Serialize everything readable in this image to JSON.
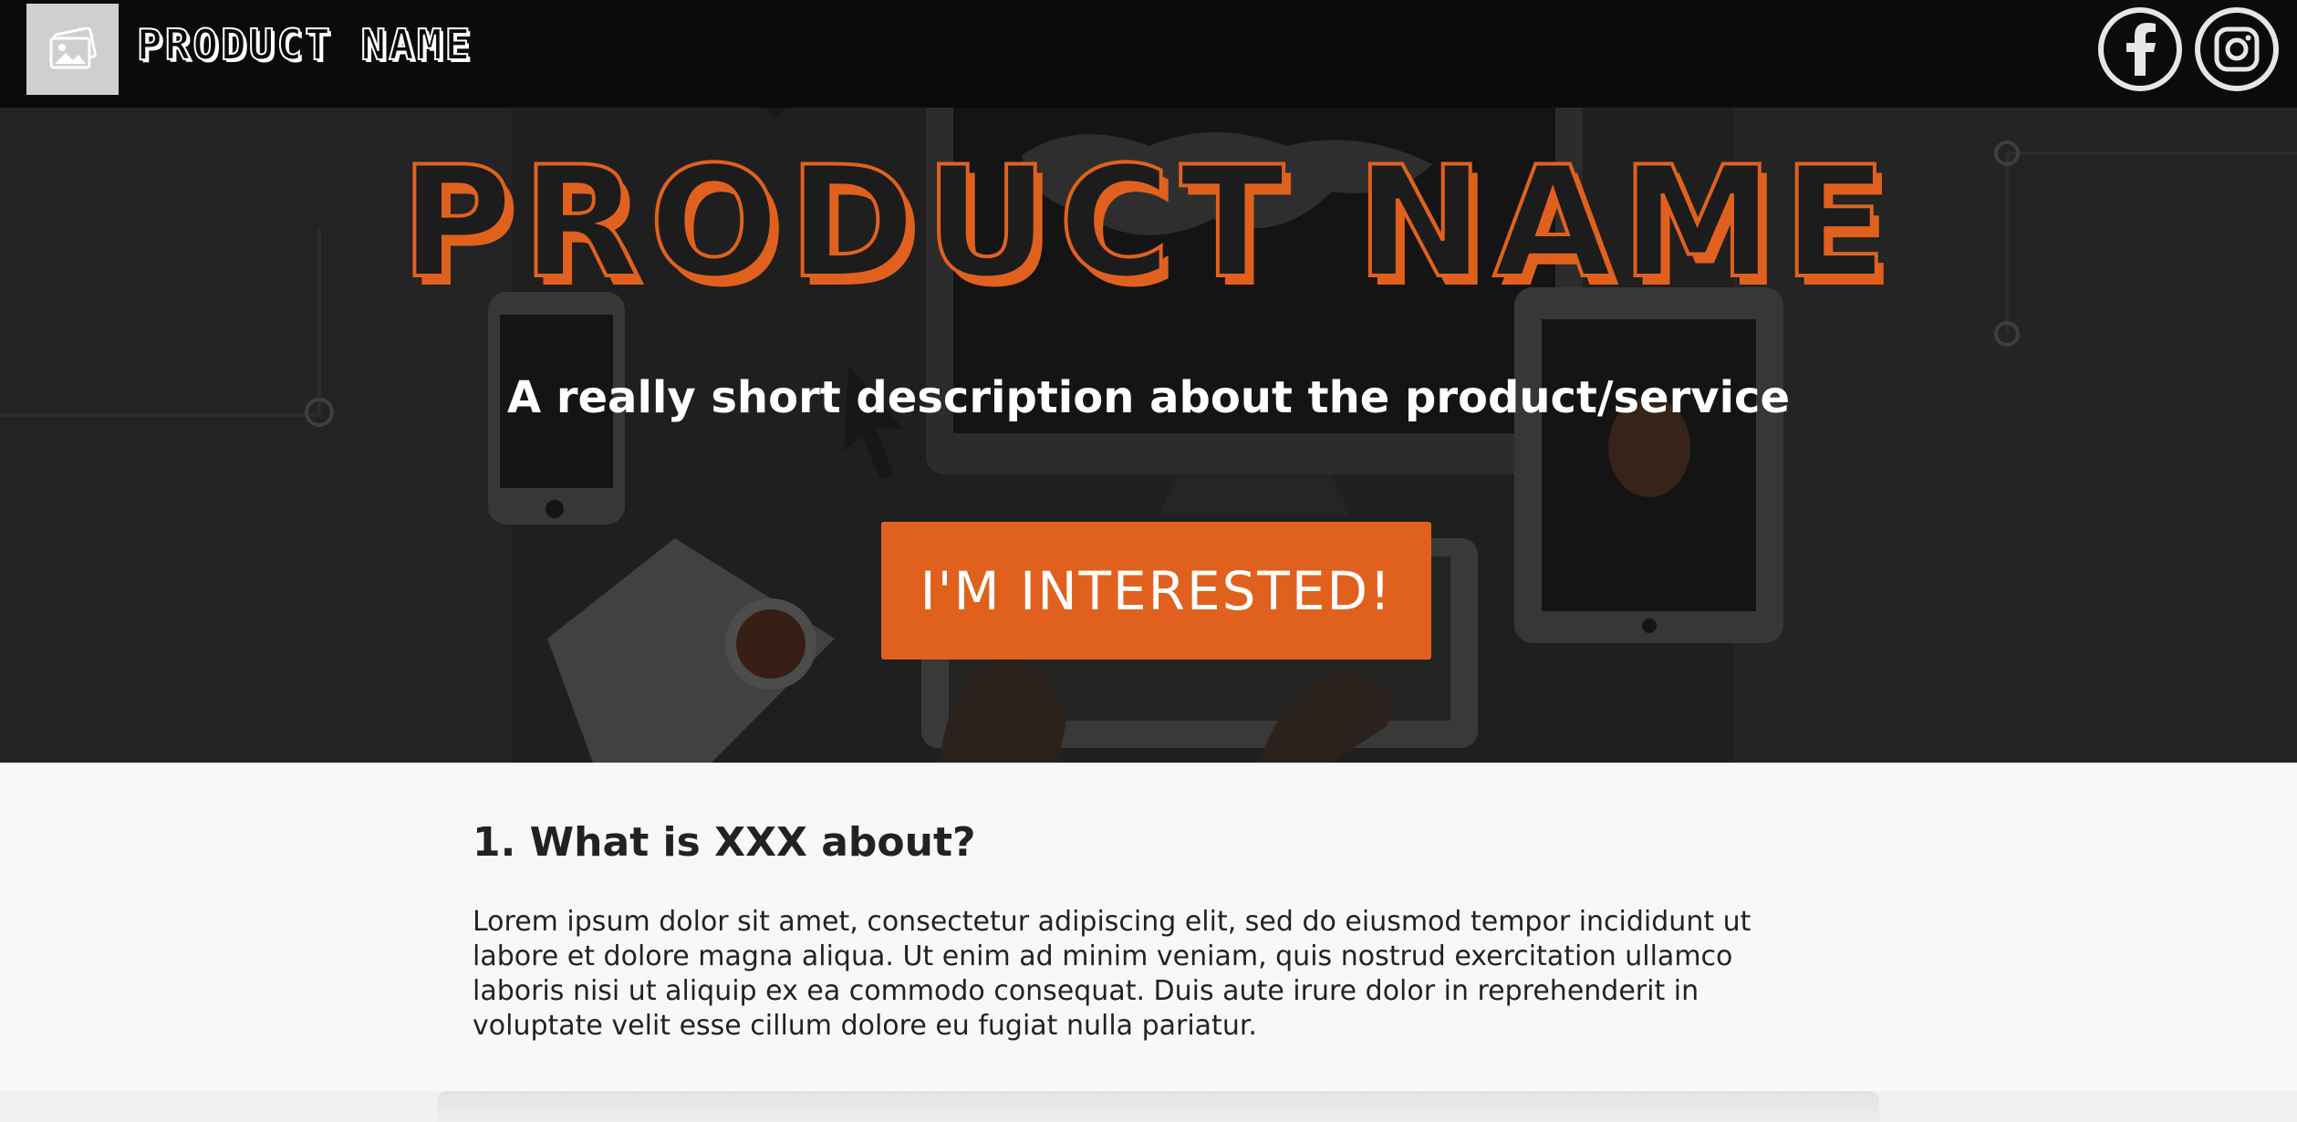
{
  "topbar": {
    "logo_icon": "image-icon",
    "brand_text": "PRODUCT NAME",
    "social": [
      {
        "icon": "facebook-icon"
      },
      {
        "icon": "instagram-icon"
      }
    ]
  },
  "hero": {
    "title": "PRODUCT NAME",
    "subtitle": "A really short description about the product/service",
    "cta_label": "I'M INTERESTED!"
  },
  "section": {
    "heading": "1. What is XXX about?",
    "body": "Lorem ipsum dolor sit amet, consectetur adipiscing elit, sed do eiusmod tempor incididunt ut labore et dolore magna aliqua. Ut enim ad minim veniam, quis nostrud exercitation ullamco laboris nisi ut aliquip ex ea commodo consequat. Duis aute irure dolor in reprehenderit in voluptate velit esse cillum dolore eu fugiat nulla pariatur."
  },
  "colors": {
    "accent": "#e0611e",
    "topbar": "#0b0b0b",
    "page_bg": "#f8f8f8",
    "text": "#222222"
  }
}
